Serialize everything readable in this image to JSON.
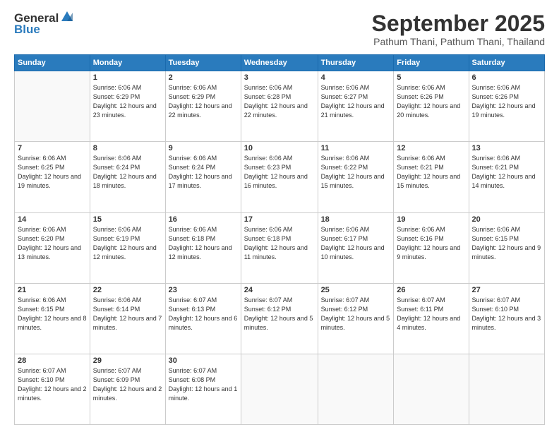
{
  "header": {
    "logo": {
      "general": "General",
      "blue": "Blue"
    },
    "title": "September 2025",
    "subtitle": "Pathum Thani, Pathum Thani, Thailand"
  },
  "weekdays": [
    "Sunday",
    "Monday",
    "Tuesday",
    "Wednesday",
    "Thursday",
    "Friday",
    "Saturday"
  ],
  "weeks": [
    [
      {
        "day": "",
        "sunrise": "",
        "sunset": "",
        "daylight": ""
      },
      {
        "day": "1",
        "sunrise": "Sunrise: 6:06 AM",
        "sunset": "Sunset: 6:29 PM",
        "daylight": "Daylight: 12 hours and 23 minutes."
      },
      {
        "day": "2",
        "sunrise": "Sunrise: 6:06 AM",
        "sunset": "Sunset: 6:29 PM",
        "daylight": "Daylight: 12 hours and 22 minutes."
      },
      {
        "day": "3",
        "sunrise": "Sunrise: 6:06 AM",
        "sunset": "Sunset: 6:28 PM",
        "daylight": "Daylight: 12 hours and 22 minutes."
      },
      {
        "day": "4",
        "sunrise": "Sunrise: 6:06 AM",
        "sunset": "Sunset: 6:27 PM",
        "daylight": "Daylight: 12 hours and 21 minutes."
      },
      {
        "day": "5",
        "sunrise": "Sunrise: 6:06 AM",
        "sunset": "Sunset: 6:26 PM",
        "daylight": "Daylight: 12 hours and 20 minutes."
      },
      {
        "day": "6",
        "sunrise": "Sunrise: 6:06 AM",
        "sunset": "Sunset: 6:26 PM",
        "daylight": "Daylight: 12 hours and 19 minutes."
      }
    ],
    [
      {
        "day": "7",
        "sunrise": "Sunrise: 6:06 AM",
        "sunset": "Sunset: 6:25 PM",
        "daylight": "Daylight: 12 hours and 19 minutes."
      },
      {
        "day": "8",
        "sunrise": "Sunrise: 6:06 AM",
        "sunset": "Sunset: 6:24 PM",
        "daylight": "Daylight: 12 hours and 18 minutes."
      },
      {
        "day": "9",
        "sunrise": "Sunrise: 6:06 AM",
        "sunset": "Sunset: 6:24 PM",
        "daylight": "Daylight: 12 hours and 17 minutes."
      },
      {
        "day": "10",
        "sunrise": "Sunrise: 6:06 AM",
        "sunset": "Sunset: 6:23 PM",
        "daylight": "Daylight: 12 hours and 16 minutes."
      },
      {
        "day": "11",
        "sunrise": "Sunrise: 6:06 AM",
        "sunset": "Sunset: 6:22 PM",
        "daylight": "Daylight: 12 hours and 15 minutes."
      },
      {
        "day": "12",
        "sunrise": "Sunrise: 6:06 AM",
        "sunset": "Sunset: 6:21 PM",
        "daylight": "Daylight: 12 hours and 15 minutes."
      },
      {
        "day": "13",
        "sunrise": "Sunrise: 6:06 AM",
        "sunset": "Sunset: 6:21 PM",
        "daylight": "Daylight: 12 hours and 14 minutes."
      }
    ],
    [
      {
        "day": "14",
        "sunrise": "Sunrise: 6:06 AM",
        "sunset": "Sunset: 6:20 PM",
        "daylight": "Daylight: 12 hours and 13 minutes."
      },
      {
        "day": "15",
        "sunrise": "Sunrise: 6:06 AM",
        "sunset": "Sunset: 6:19 PM",
        "daylight": "Daylight: 12 hours and 12 minutes."
      },
      {
        "day": "16",
        "sunrise": "Sunrise: 6:06 AM",
        "sunset": "Sunset: 6:18 PM",
        "daylight": "Daylight: 12 hours and 12 minutes."
      },
      {
        "day": "17",
        "sunrise": "Sunrise: 6:06 AM",
        "sunset": "Sunset: 6:18 PM",
        "daylight": "Daylight: 12 hours and 11 minutes."
      },
      {
        "day": "18",
        "sunrise": "Sunrise: 6:06 AM",
        "sunset": "Sunset: 6:17 PM",
        "daylight": "Daylight: 12 hours and 10 minutes."
      },
      {
        "day": "19",
        "sunrise": "Sunrise: 6:06 AM",
        "sunset": "Sunset: 6:16 PM",
        "daylight": "Daylight: 12 hours and 9 minutes."
      },
      {
        "day": "20",
        "sunrise": "Sunrise: 6:06 AM",
        "sunset": "Sunset: 6:15 PM",
        "daylight": "Daylight: 12 hours and 9 minutes."
      }
    ],
    [
      {
        "day": "21",
        "sunrise": "Sunrise: 6:06 AM",
        "sunset": "Sunset: 6:15 PM",
        "daylight": "Daylight: 12 hours and 8 minutes."
      },
      {
        "day": "22",
        "sunrise": "Sunrise: 6:06 AM",
        "sunset": "Sunset: 6:14 PM",
        "daylight": "Daylight: 12 hours and 7 minutes."
      },
      {
        "day": "23",
        "sunrise": "Sunrise: 6:07 AM",
        "sunset": "Sunset: 6:13 PM",
        "daylight": "Daylight: 12 hours and 6 minutes."
      },
      {
        "day": "24",
        "sunrise": "Sunrise: 6:07 AM",
        "sunset": "Sunset: 6:12 PM",
        "daylight": "Daylight: 12 hours and 5 minutes."
      },
      {
        "day": "25",
        "sunrise": "Sunrise: 6:07 AM",
        "sunset": "Sunset: 6:12 PM",
        "daylight": "Daylight: 12 hours and 5 minutes."
      },
      {
        "day": "26",
        "sunrise": "Sunrise: 6:07 AM",
        "sunset": "Sunset: 6:11 PM",
        "daylight": "Daylight: 12 hours and 4 minutes."
      },
      {
        "day": "27",
        "sunrise": "Sunrise: 6:07 AM",
        "sunset": "Sunset: 6:10 PM",
        "daylight": "Daylight: 12 hours and 3 minutes."
      }
    ],
    [
      {
        "day": "28",
        "sunrise": "Sunrise: 6:07 AM",
        "sunset": "Sunset: 6:10 PM",
        "daylight": "Daylight: 12 hours and 2 minutes."
      },
      {
        "day": "29",
        "sunrise": "Sunrise: 6:07 AM",
        "sunset": "Sunset: 6:09 PM",
        "daylight": "Daylight: 12 hours and 2 minutes."
      },
      {
        "day": "30",
        "sunrise": "Sunrise: 6:07 AM",
        "sunset": "Sunset: 6:08 PM",
        "daylight": "Daylight: 12 hours and 1 minute."
      },
      {
        "day": "",
        "sunrise": "",
        "sunset": "",
        "daylight": ""
      },
      {
        "day": "",
        "sunrise": "",
        "sunset": "",
        "daylight": ""
      },
      {
        "day": "",
        "sunrise": "",
        "sunset": "",
        "daylight": ""
      },
      {
        "day": "",
        "sunrise": "",
        "sunset": "",
        "daylight": ""
      }
    ]
  ]
}
